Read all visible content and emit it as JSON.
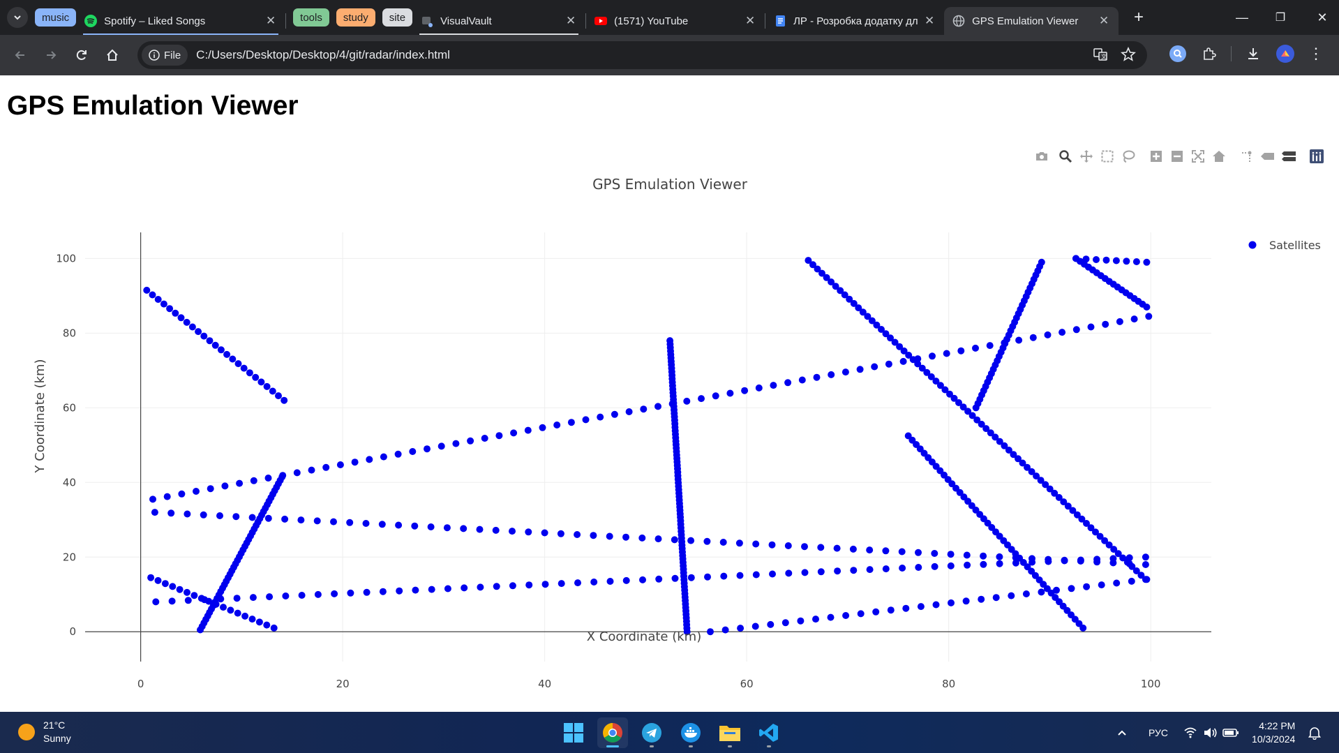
{
  "browser": {
    "groups": [
      {
        "label": "music",
        "color": "#8ab4f8"
      },
      {
        "label": "tools",
        "color": "#81c995"
      },
      {
        "label": "study",
        "color": "#fcad70"
      },
      {
        "label": "site",
        "color": "#dadce0"
      }
    ],
    "tabs": [
      {
        "title": "Spotify – Liked Songs",
        "icon": "spotify-icon"
      },
      {
        "title": "VisualVault",
        "icon": "visualvault-icon"
      },
      {
        "title": "(1571) YouTube",
        "icon": "youtube-icon"
      },
      {
        "title": "ЛР - Розробка додатку дл",
        "icon": "google-docs-icon"
      },
      {
        "title": "GPS Emulation Viewer",
        "icon": "globe-icon",
        "active": true
      }
    ],
    "address": {
      "chip": "File",
      "url": "C:/Users/Desktop/Desktop/4/git/radar/index.html"
    }
  },
  "page": {
    "heading": "GPS Emulation Viewer"
  },
  "chart_data": {
    "type": "scatter",
    "title": "GPS Emulation Viewer",
    "xlabel": "X Coordinate (km)",
    "ylabel": "Y Coordinate (km)",
    "xlim": [
      -5.5,
      106
    ],
    "ylim": [
      -8,
      107
    ],
    "xticks": [
      0,
      20,
      40,
      60,
      80,
      100
    ],
    "yticks": [
      0,
      20,
      40,
      60,
      80,
      100
    ],
    "grid": true,
    "legend": "top-right",
    "marker_color": "#0000ee",
    "series": [
      {
        "name": "Satellites",
        "tracks": [
          {
            "from": [
              0.6,
              91.5
            ],
            "to": [
              14.2,
              62.0
            ],
            "points": 25
          },
          {
            "from": [
              14.0,
              41.5
            ],
            "to": [
              5.9,
              0.5
            ],
            "points": 45
          },
          {
            "from": [
              1.2,
              35.5
            ],
            "to": [
              99.8,
              84.5
            ],
            "points": 70
          },
          {
            "from": [
              1.4,
              32.0
            ],
            "to": [
              99.5,
              18.0
            ],
            "points": 62
          },
          {
            "from": [
              1.5,
              8.0
            ],
            "to": [
              99.5,
              20.0
            ],
            "points": 62
          },
          {
            "from": [
              1.0,
              14.5
            ],
            "to": [
              13.2,
              1.0
            ],
            "points": 18
          },
          {
            "from": [
              52.4,
              78.0
            ],
            "to": [
              54.1,
              0.0
            ],
            "points": 85
          },
          {
            "from": [
              56.4,
              0.0
            ],
            "to": [
              99.6,
              14.0
            ],
            "points": 30
          },
          {
            "from": [
              66.1,
              99.5
            ],
            "to": [
              99.5,
              14.0
            ],
            "points": 75
          },
          {
            "from": [
              76.0,
              52.5
            ],
            "to": [
              93.3,
              1.0
            ],
            "points": 45
          },
          {
            "from": [
              82.7,
              60.0
            ],
            "to": [
              89.2,
              99.0
            ],
            "points": 35
          },
          {
            "from": [
              92.6,
              100.0
            ],
            "to": [
              99.6,
              87.0
            ],
            "points": 18
          },
          {
            "from": [
              92.6,
              100.0
            ],
            "to": [
              99.6,
              99.0
            ],
            "points": 8
          }
        ]
      }
    ]
  },
  "taskbar": {
    "weather": {
      "temp": "21°C",
      "condition": "Sunny"
    },
    "lang": "РУС",
    "time": "4:22 PM",
    "date": "10/3/2024"
  }
}
